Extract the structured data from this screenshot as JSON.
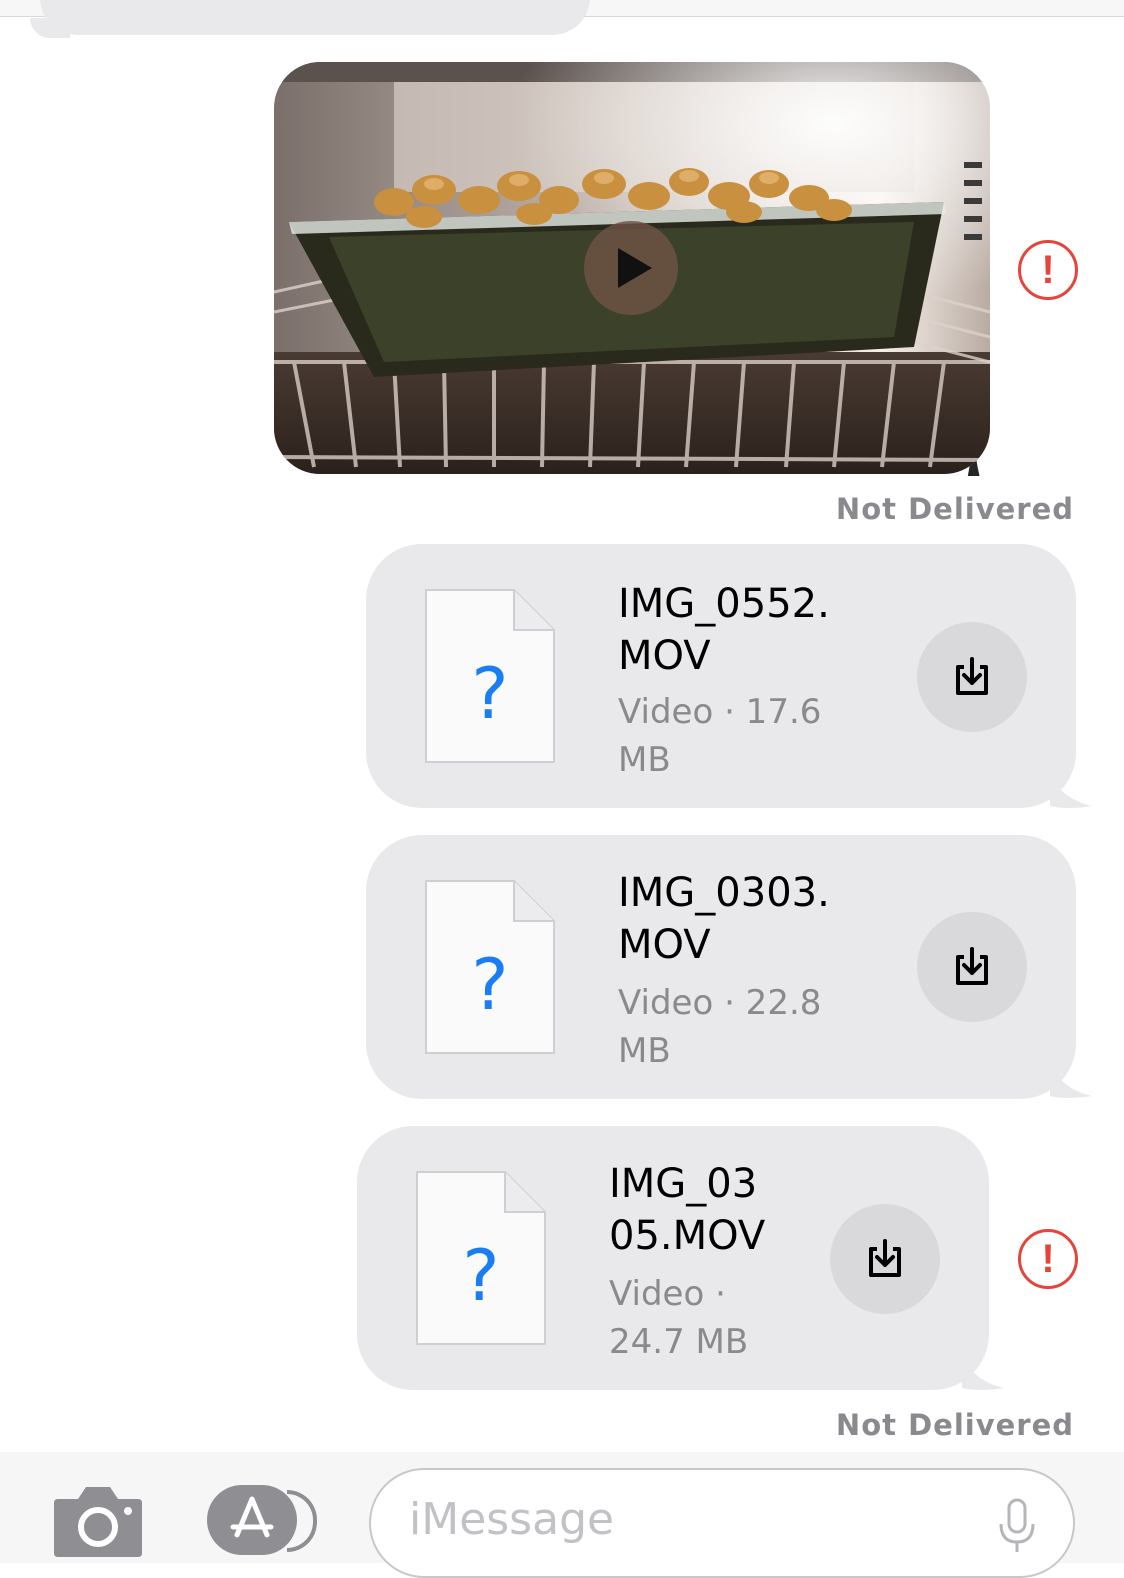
{
  "conversation": {
    "video_message": {
      "status": "Not Delivered",
      "error_symbol": "!",
      "play_icon": "play-icon"
    },
    "attachments": [
      {
        "name": "IMG_0552.\nMOV",
        "meta": "Video · 17.6\nMB",
        "icon": "unknown-file-icon",
        "unknown_glyph": "?",
        "action_icon": "download-icon"
      },
      {
        "name": "IMG_0303.\nMOV",
        "meta": "Video · 22.8\nMB",
        "icon": "unknown-file-icon",
        "unknown_glyph": "?",
        "action_icon": "download-icon"
      },
      {
        "name": "IMG_03\n05.MOV",
        "meta": "Video ·\n24.7 MB",
        "icon": "unknown-file-icon",
        "unknown_glyph": "?",
        "action_icon": "download-icon",
        "error_symbol": "!",
        "status": "Not Delivered"
      }
    ]
  },
  "composer": {
    "placeholder": "iMessage",
    "camera_icon": "camera-icon",
    "apps_icon": "app-store-icon",
    "mic_icon": "microphone-icon"
  },
  "colors": {
    "bubble_gray": "#e9e9eb",
    "error_red": "#e5443a",
    "link_blue": "#1a7ef2",
    "status_gray": "#8a8a8e"
  }
}
